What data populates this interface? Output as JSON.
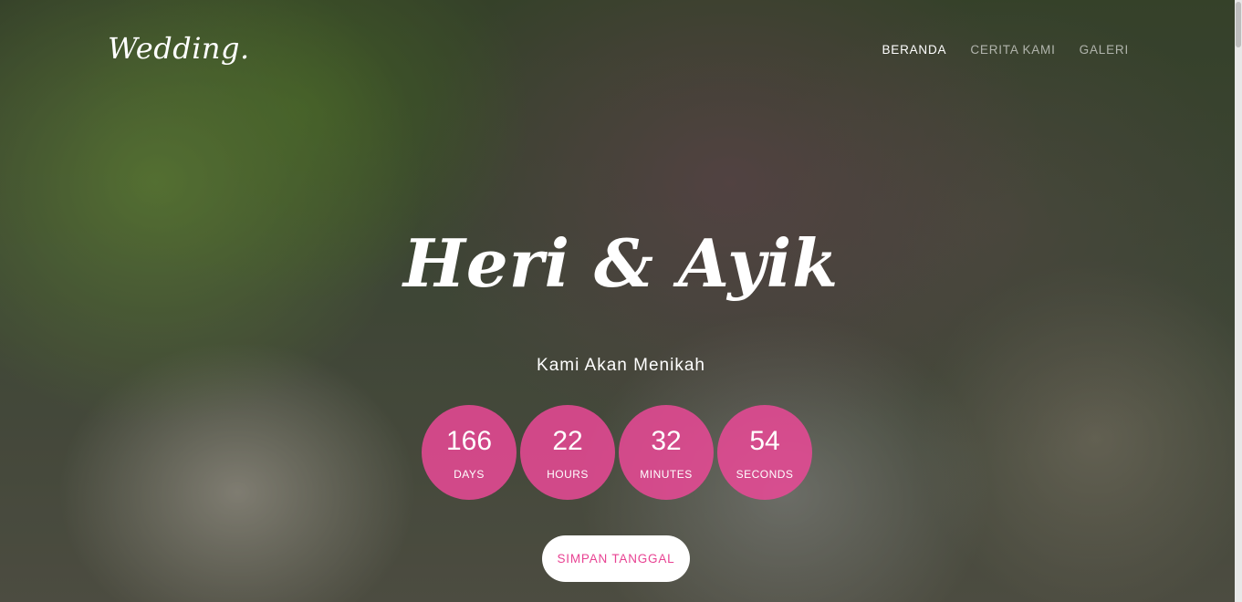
{
  "header": {
    "logo": "Wedding.",
    "nav": [
      {
        "label": "BERANDA",
        "active": true
      },
      {
        "label": "CERITA KAMI",
        "active": false
      },
      {
        "label": "GALERI",
        "active": false
      }
    ]
  },
  "hero": {
    "title": "Heri & Ayik",
    "subtitle": "Kami Akan Menikah",
    "countdown": [
      {
        "value": "166",
        "label": "DAYS"
      },
      {
        "value": "22",
        "label": "HOURS"
      },
      {
        "value": "32",
        "label": "MINUTES"
      },
      {
        "value": "54",
        "label": "SECONDS"
      }
    ],
    "button_label": "SIMPAN TANGGAL"
  },
  "colors": {
    "accent": "#ea4996",
    "button_text": "#e84393",
    "text": "#ffffff"
  }
}
